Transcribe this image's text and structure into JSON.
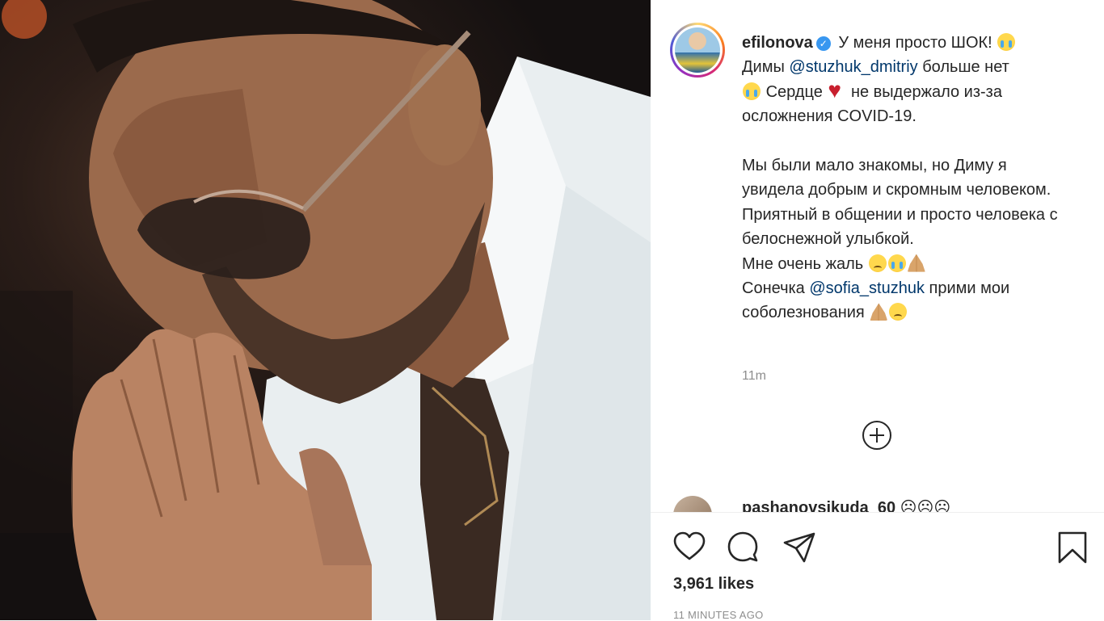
{
  "post": {
    "username": "efilonova",
    "verified": true,
    "caption_parts": {
      "l1a": "У меня просто ШОК!",
      "l2a": "Димы",
      "mention1": "@stuzhuk_dmitriy",
      "l2b": "больше нет",
      "l3a": "Сердце",
      "l3b": "не выдержало из-за",
      "l4": "осложнения COVID-19.",
      "p2": "Мы были мало знакомы, но Диму я увидела добрым и скромным человеком. Приятный в общении и просто человека с белоснежной улыбкой.",
      "p3": "Мне очень жаль",
      "p4a": "Сонечка",
      "mention2": "@sofia_stuzhuk",
      "p4b": "прими мои соболезнования"
    },
    "time_ago": "11m",
    "comment_preview_text": "pashanovsjkuda_60 ☹☹☹",
    "likes": "3,961 likes",
    "posted_label": "11 MINUTES AGO"
  },
  "icons": {
    "verified": "verified-badge-icon",
    "more": "add-circle-icon",
    "like": "heart-icon",
    "comment": "comment-bubble-icon",
    "share": "paper-plane-icon",
    "save": "bookmark-icon"
  },
  "colors": {
    "verified": "#3897f0",
    "mention": "#00376b",
    "muted": "#8e8e8e",
    "text": "#262626"
  }
}
